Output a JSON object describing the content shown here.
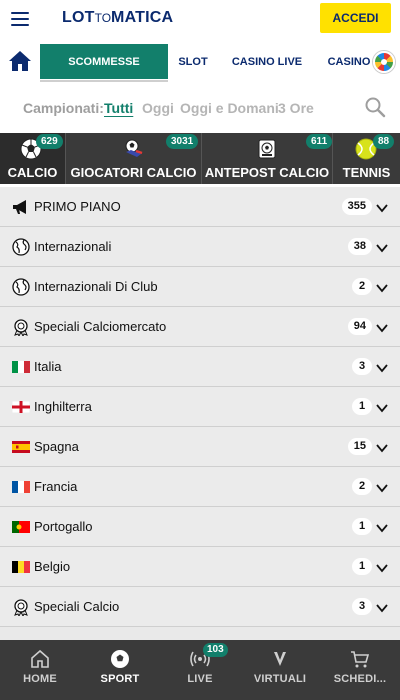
{
  "header": {
    "logo": {
      "part1": "LOT",
      "part2": "TO",
      "part3": "MATICA"
    },
    "login_label": "ACCEDI",
    "accent": "#ffe100",
    "brand_color": "#0b2a6e"
  },
  "product_nav": {
    "tabs": [
      {
        "label": "SCOMMESSE",
        "active": true
      },
      {
        "label": "SLOT",
        "active": false
      },
      {
        "label": "CASINO LIVE",
        "active": false
      },
      {
        "label": "CASINO",
        "active": false
      }
    ],
    "active_color": "#127f6b"
  },
  "filter": {
    "label": "Campionati:",
    "options": [
      {
        "label": "Tutti",
        "active": true
      },
      {
        "label": "Oggi",
        "active": false
      },
      {
        "label": "Oggi e Domani",
        "active": false
      },
      {
        "label": "3 Ore",
        "active": false
      }
    ]
  },
  "sports": [
    {
      "name": "CALCIO",
      "count": "629",
      "icon": "soccer-ball-icon",
      "active": true
    },
    {
      "name": "GIOCATORI CALCIO",
      "count": "3031",
      "icon": "soccer-player-icon",
      "active": false
    },
    {
      "name": "ANTEPOST CALCIO",
      "count": "611",
      "icon": "trophy-icon",
      "active": false
    },
    {
      "name": "TENNIS",
      "count": "88",
      "icon": "tennis-ball-icon",
      "active": false
    }
  ],
  "leagues": [
    {
      "label": "PRIMO PIANO",
      "count": "355",
      "icon": "megaphone-icon"
    },
    {
      "label": "Internazionali",
      "count": "38",
      "icon": "globe-icon"
    },
    {
      "label": "Internazionali Di Club",
      "count": "2",
      "icon": "globe-icon"
    },
    {
      "label": "Speciali Calciomercato",
      "count": "94",
      "icon": "medal-icon"
    },
    {
      "label": "Italia",
      "count": "3",
      "icon": "flag-italy-icon"
    },
    {
      "label": "Inghilterra",
      "count": "1",
      "icon": "flag-england-icon"
    },
    {
      "label": "Spagna",
      "count": "15",
      "icon": "flag-spain-icon"
    },
    {
      "label": "Francia",
      "count": "2",
      "icon": "flag-france-icon"
    },
    {
      "label": "Portogallo",
      "count": "1",
      "icon": "flag-portugal-icon"
    },
    {
      "label": "Belgio",
      "count": "1",
      "icon": "flag-belgium-icon"
    },
    {
      "label": "Speciali Calcio",
      "count": "3",
      "icon": "medal-icon"
    }
  ],
  "bottom_nav": [
    {
      "label": "HOME",
      "icon": "home-icon",
      "active": false
    },
    {
      "label": "SPORT",
      "icon": "soccer-ball-icon",
      "active": true
    },
    {
      "label": "LIVE",
      "icon": "live-signal-icon",
      "active": false,
      "badge": "103"
    },
    {
      "label": "VIRTUALI",
      "icon": "virtual-v-icon",
      "active": false
    },
    {
      "label": "SCHEDI...",
      "icon": "cart-icon",
      "active": false
    }
  ]
}
